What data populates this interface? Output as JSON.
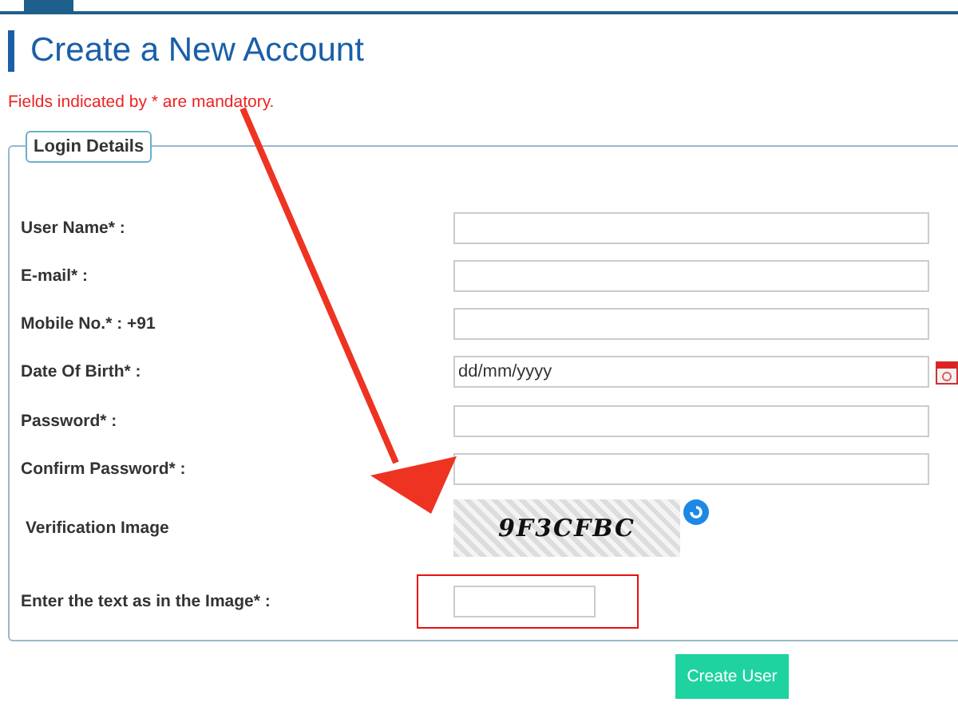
{
  "page": {
    "title": "Create a New Account",
    "note": "Fields indicated by * are mandatory."
  },
  "fieldset": {
    "legend": "Login Details",
    "fields": [
      {
        "kind": "text",
        "label": "User Name* :"
      },
      {
        "kind": "text",
        "label": "E-mail* :"
      },
      {
        "kind": "text",
        "label": "Mobile No.* : +91"
      },
      {
        "kind": "date",
        "label": "Date Of Birth* :",
        "placeholder": "dd/mm/yyyy"
      },
      {
        "kind": "text",
        "label": "Password* :"
      },
      {
        "kind": "text",
        "label": "Confirm Password* :"
      },
      {
        "kind": "captcha",
        "label": "Verification Image",
        "captcha_text": "9F3CFBC"
      },
      {
        "kind": "short",
        "label": "Enter the text as in the Image* :",
        "highlighted": true
      }
    ]
  },
  "submit": {
    "label": "Create User"
  }
}
